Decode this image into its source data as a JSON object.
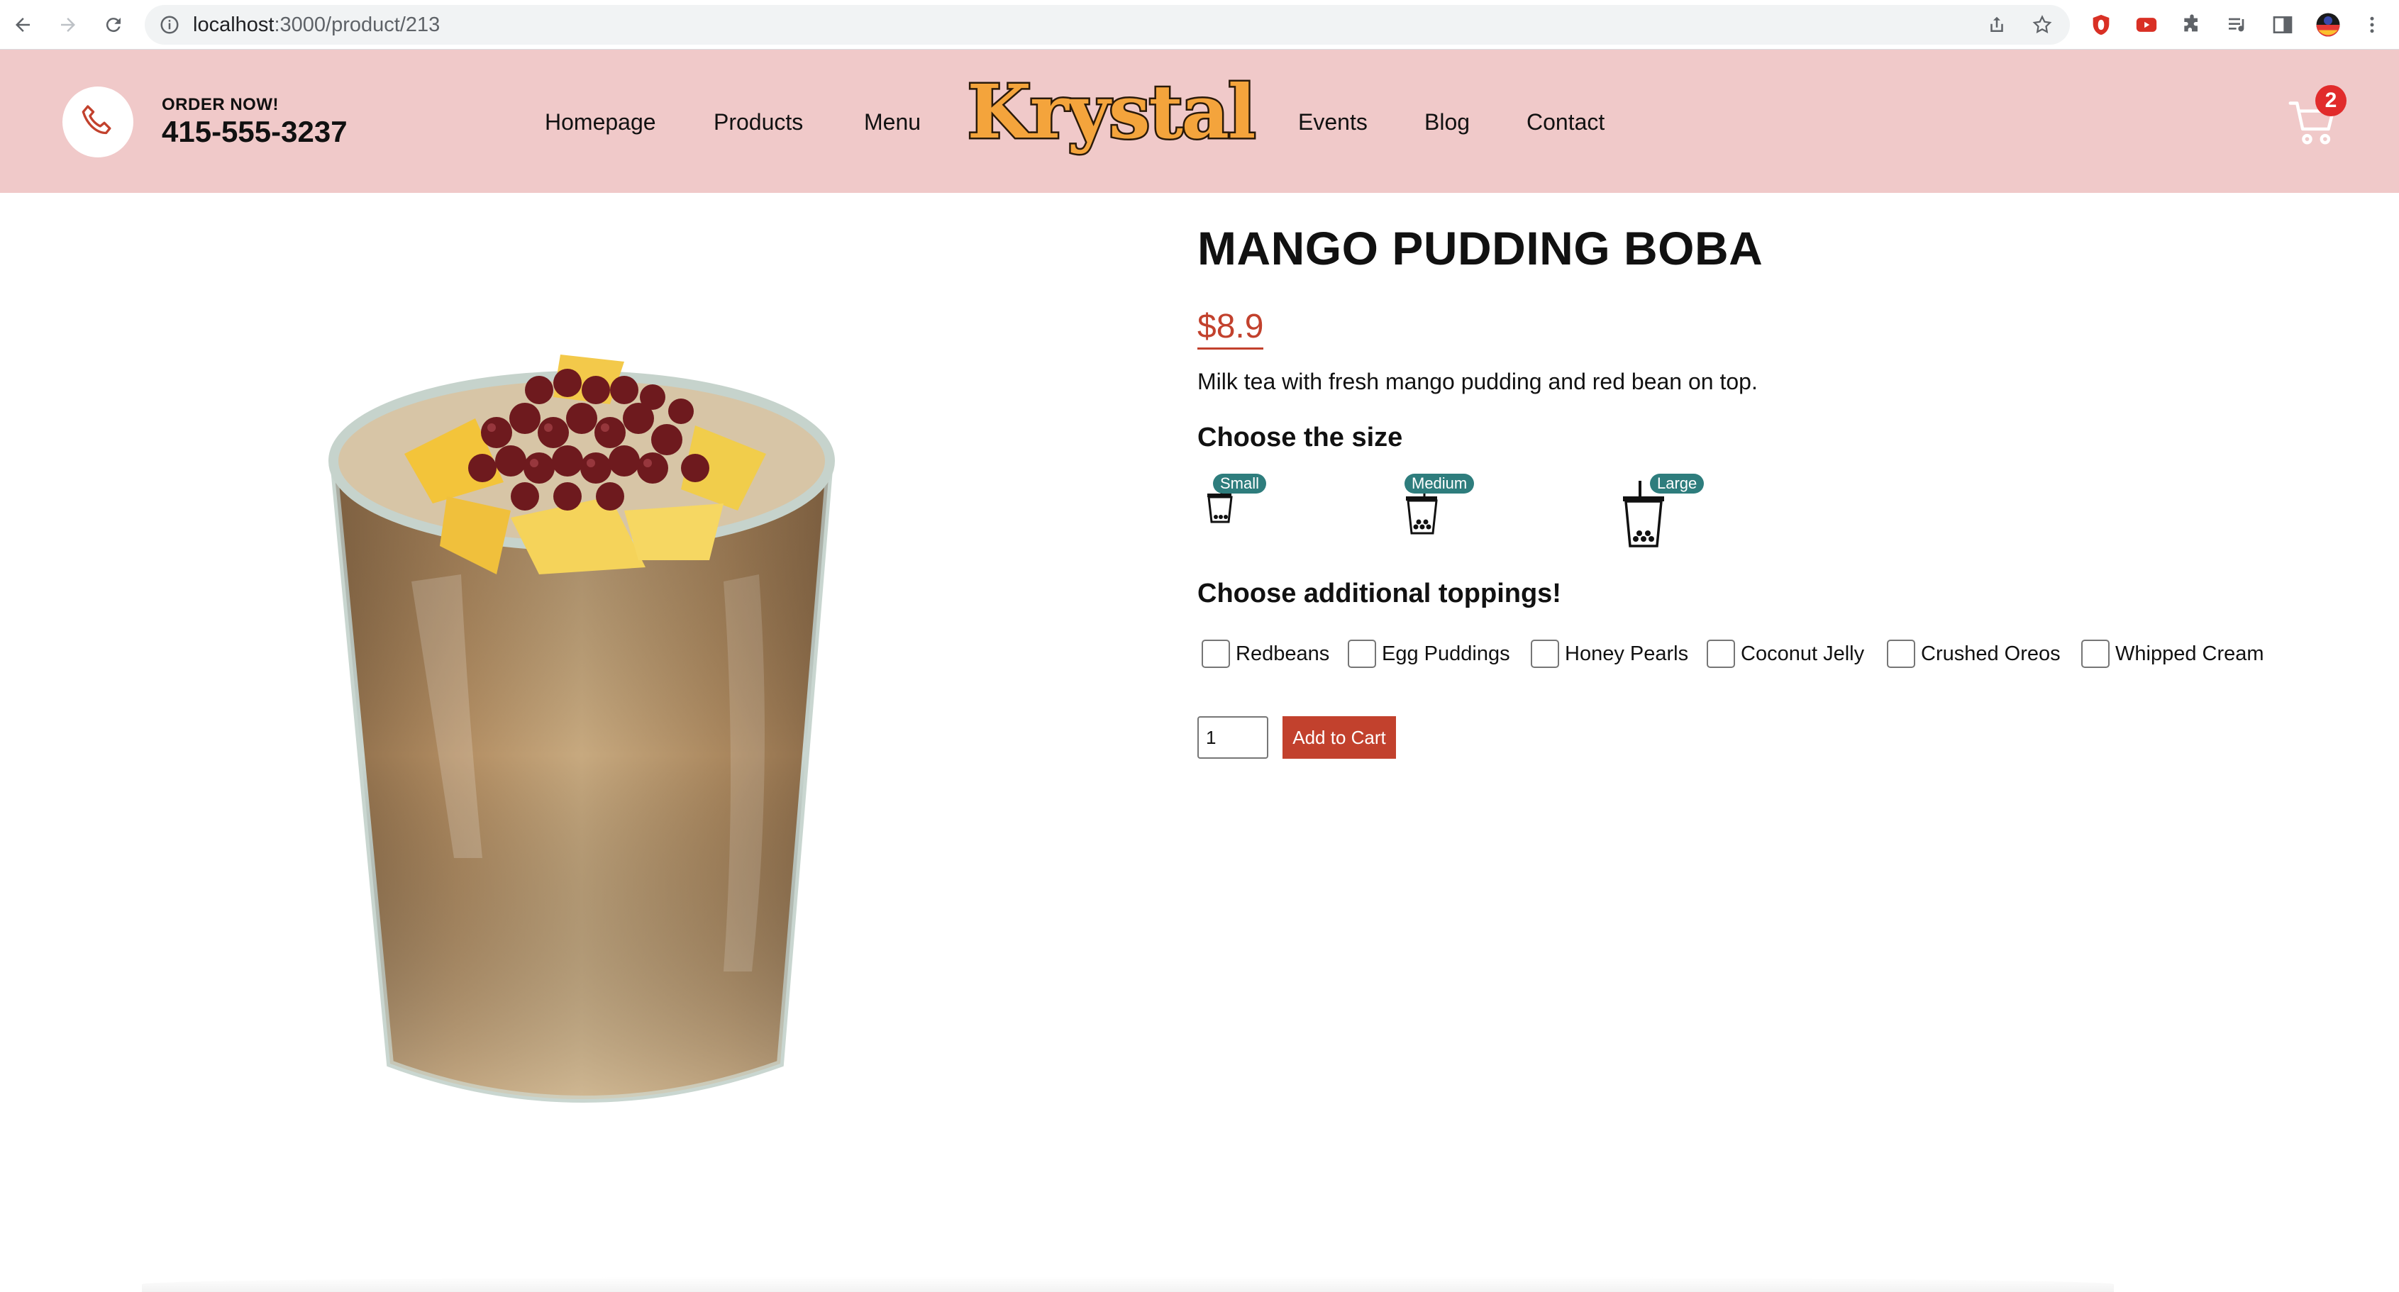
{
  "browser": {
    "url_host": "localhost",
    "url_path": ":3000/product/213"
  },
  "header": {
    "order_label": "ORDER NOW!",
    "phone": "415-555-3237",
    "nav_left": [
      "Homepage",
      "Products",
      "Menu"
    ],
    "logo_text": "Krystal",
    "nav_right": [
      "Events",
      "Blog",
      "Contact"
    ],
    "cart_count": "2"
  },
  "product": {
    "title": "MANGO PUDDING BOBA",
    "price": "$8.9",
    "description": "Milk tea with fresh mango pudding and red bean on top.",
    "size_heading": "Choose the size",
    "sizes": [
      "Small",
      "Medium",
      "Large"
    ],
    "toppings_heading": "Choose additional toppings!",
    "toppings": [
      "Redbeans",
      "Egg Puddings",
      "Honey Pearls",
      "Coconut Jelly",
      "Crushed Oreos",
      "Whipped Cream"
    ],
    "quantity": "1",
    "add_to_cart": "Add to Cart"
  },
  "colors": {
    "header_bg": "#f0c9c9",
    "accent": "#c2412d",
    "badge": "#2e7d7d",
    "cart_badge": "#e12b2b"
  }
}
